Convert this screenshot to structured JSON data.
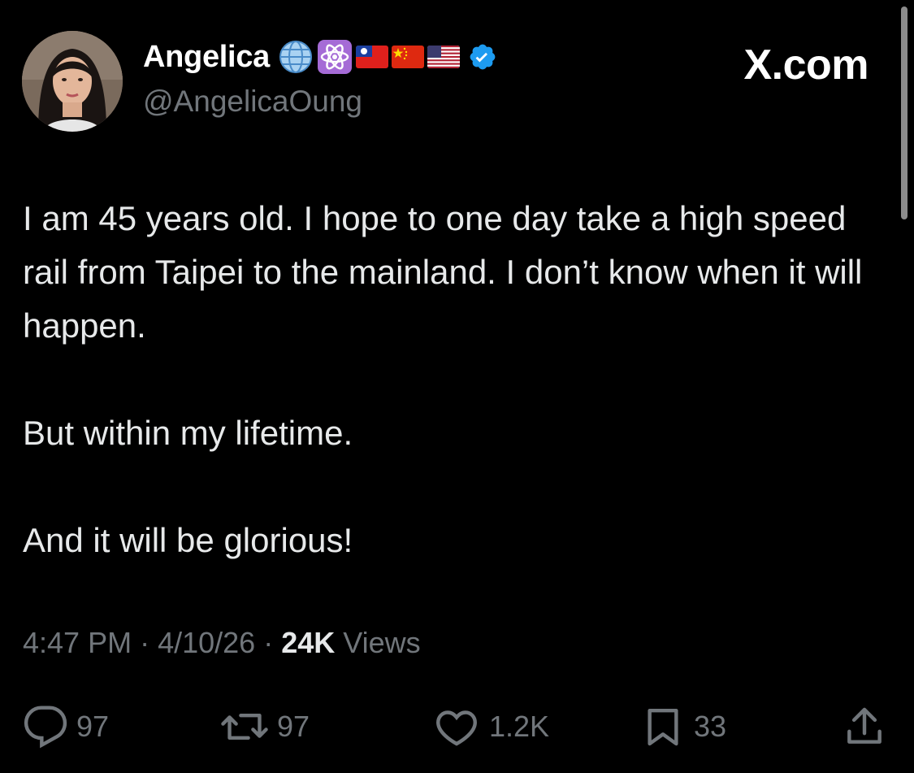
{
  "user": {
    "display_name": "Angelica",
    "handle": "@AngelicaOung",
    "badges": [
      "globe-emoji",
      "atom-emoji",
      "taiwan-flag",
      "china-flag",
      "usa-flag",
      "verified-badge"
    ]
  },
  "brand": "X.com",
  "tweet": {
    "paragraphs": [
      "I am 45 years old. I hope to one day take a high speed rail from Taipei to the mainland. I don’t know when it will happen.",
      "But within my lifetime.",
      "And it will be glorious!"
    ]
  },
  "meta": {
    "time": "4:47 PM",
    "sep1": " · ",
    "date": "4/10/26",
    "sep2": " · ",
    "views_count": "24K",
    "views_label": " Views"
  },
  "actions": {
    "replies": "97",
    "reposts": "97",
    "likes": "1.2K",
    "bookmarks": "33"
  },
  "colors": {
    "background": "#000000",
    "text": "#e7e9ea",
    "muted": "#71767b",
    "verified": "#1d9bf0"
  }
}
